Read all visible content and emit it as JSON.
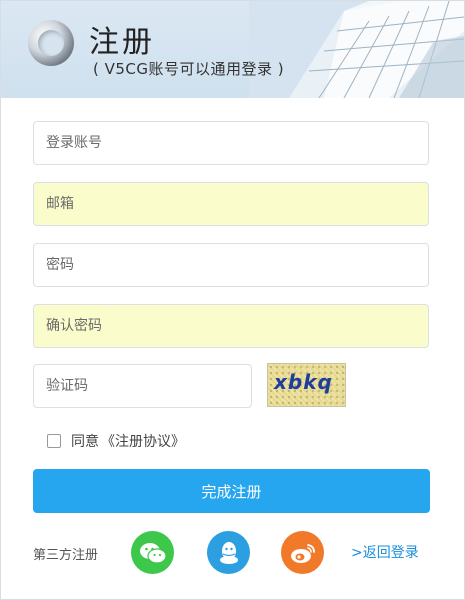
{
  "header": {
    "title": "注册",
    "subtitle": "( V5CG账号可以通用登录 )"
  },
  "form": {
    "account_placeholder": "登录账号",
    "email_placeholder": "邮箱",
    "password_placeholder": "密码",
    "confirm_placeholder": "确认密码",
    "captcha_placeholder": "验证码",
    "captcha_text": "xbkq",
    "agree_prefix": "同意",
    "agree_link": "《注册协议》",
    "agree_checked": false,
    "submit_label": "完成注册"
  },
  "footer": {
    "third_party_label": "第三方注册",
    "social_icons": [
      "wechat-icon",
      "qq-icon",
      "weibo-icon"
    ],
    "back_label": ">返回登录"
  },
  "colors": {
    "accent": "#25a6ee",
    "autofill": "#fafdcb",
    "wechat": "#3ec84b",
    "qq": "#2c9fe0",
    "weibo": "#f07a2a",
    "link": "#1a8fd9"
  }
}
